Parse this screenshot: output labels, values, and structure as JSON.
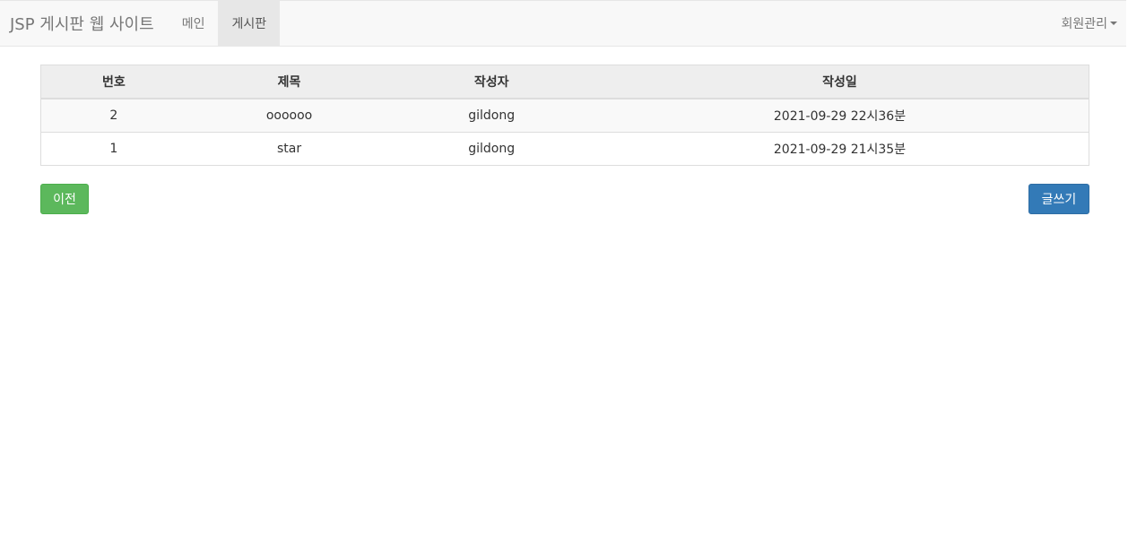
{
  "navbar": {
    "brand": "JSP 게시판 웹 사이트",
    "items": [
      {
        "label": "메인"
      },
      {
        "label": "게시판"
      }
    ],
    "member_menu": "회원관리"
  },
  "board": {
    "headers": {
      "number": "번호",
      "title": "제목",
      "writer": "작성자",
      "date": "작성일"
    },
    "rows": [
      {
        "number": "2",
        "title": "oooooo",
        "writer": "gildong",
        "date": "2021-09-29 22시36분"
      },
      {
        "number": "1",
        "title": "star",
        "writer": "gildong",
        "date": "2021-09-29 21시35분"
      }
    ]
  },
  "buttons": {
    "prev": "이전",
    "write": "글쓰기"
  },
  "colors": {
    "navbar_bg": "#f8f8f8",
    "active_nav_bg": "#e7e7e7",
    "success": "#5cb85c",
    "primary": "#337ab7"
  }
}
